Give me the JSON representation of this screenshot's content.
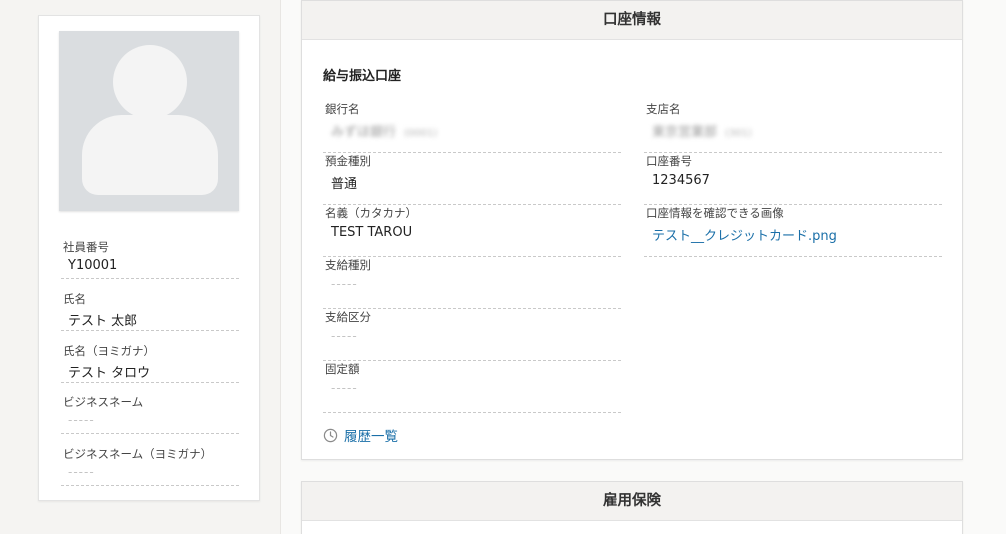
{
  "profile": {
    "fields": [
      {
        "label": "社員番号",
        "value": "Y10001"
      },
      {
        "label": "氏名",
        "value": "テスト 太郎"
      },
      {
        "label": "氏名（ヨミガナ）",
        "value": "テスト タロウ"
      },
      {
        "label": "ビジネスネーム",
        "value": "-----"
      },
      {
        "label": "ビジネスネーム（ヨミガナ）",
        "value": "-----"
      }
    ]
  },
  "account_card": {
    "title": "口座情報",
    "section_title": "給与振込口座",
    "left_fields": [
      {
        "label": "銀行名",
        "value": "みずほ銀行",
        "sub": "(0001)"
      },
      {
        "label": "預金種別",
        "value": "普通"
      },
      {
        "label": "名義（カタカナ）",
        "value": "TEST TAROU"
      },
      {
        "label": "支給種別",
        "value": "-----"
      },
      {
        "label": "支給区分",
        "value": "-----"
      },
      {
        "label": "固定額",
        "value": "-----"
      }
    ],
    "right_fields": [
      {
        "label": "支店名",
        "value": "東京営業部",
        "sub": "(301)"
      },
      {
        "label": "口座番号",
        "value": "1234567"
      },
      {
        "label": "口座情報を確認できる画像",
        "value": "テスト__クレジットカード.png"
      }
    ],
    "history_label": "履歴一覧",
    "history_icon": "clock-icon"
  },
  "employment_card": {
    "title": "雇用保険"
  },
  "colors": {
    "link": "#1a6fa8",
    "header_bg": "#f3f2f0",
    "avatar_bg": "#dadde0"
  }
}
